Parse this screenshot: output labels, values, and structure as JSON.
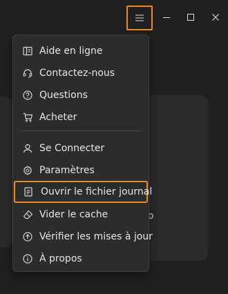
{
  "window": {
    "menu_icon": "hamburger-icon",
    "minimize_icon": "minimize-icon",
    "maximize_icon": "maximize-icon",
    "close_icon": "close-icon",
    "highlight_color": "#f08a1c"
  },
  "background": {
    "fragment_text": "o"
  },
  "menu": {
    "items_group1": [
      {
        "label": "Aide en ligne",
        "icon": "book-open-icon"
      },
      {
        "label": "Contactez-nous",
        "icon": "headset-icon"
      },
      {
        "label": "Questions",
        "icon": "question-circle-icon"
      },
      {
        "label": "Acheter",
        "icon": "cart-icon"
      }
    ],
    "items_group2": [
      {
        "label": "Se Connecter",
        "icon": "person-icon"
      },
      {
        "label": "Paramètres",
        "icon": "gear-icon"
      },
      {
        "label": "Ouvrir le fichier journal",
        "icon": "document-icon"
      },
      {
        "label": "Vider le cache",
        "icon": "eraser-icon"
      },
      {
        "label": "Vérifier les mises à jour",
        "icon": "arrow-up-circle-icon"
      },
      {
        "label": "À propos",
        "icon": "info-circle-icon"
      }
    ]
  }
}
